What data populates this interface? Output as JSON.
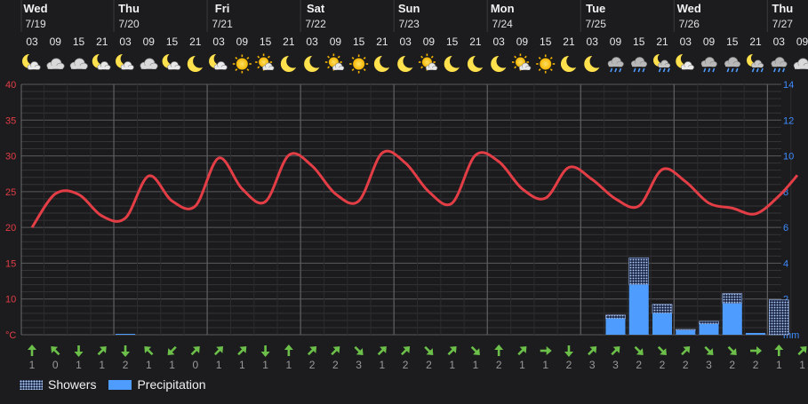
{
  "chart_data": {
    "type": "line+bar",
    "x_step_hours": 6,
    "days": [
      {
        "name": "Wed",
        "date": "7/19",
        "slot": 0
      },
      {
        "name": "Thu",
        "date": "7/20",
        "slot": 4
      },
      {
        "name": "Fri",
        "date": "7/21",
        "slot": 8
      },
      {
        "name": "Sat",
        "date": "7/22",
        "slot": 12
      },
      {
        "name": "Sun",
        "date": "7/23",
        "slot": 16
      },
      {
        "name": "Mon",
        "date": "7/24",
        "slot": 20
      },
      {
        "name": "Tue",
        "date": "7/25",
        "slot": 24
      },
      {
        "name": "Wed",
        "date": "7/26",
        "slot": 28
      },
      {
        "name": "Thu",
        "date": "7/27",
        "slot": 32
      }
    ],
    "hours": [
      "03",
      "09",
      "15",
      "21",
      "03",
      "09",
      "15",
      "21",
      "03",
      "09",
      "15",
      "21",
      "03",
      "09",
      "15",
      "21",
      "03",
      "09",
      "15",
      "21",
      "03",
      "09",
      "15",
      "21",
      "03",
      "09",
      "15",
      "21",
      "03",
      "09",
      "15",
      "21",
      "03",
      "09"
    ],
    "weather_icons": [
      "moon-cloud",
      "cloudy",
      "cloudy",
      "moon-cloud",
      "moon-cloud",
      "cloudy",
      "moon-cloud",
      "moon",
      "moon-cloud",
      "sun",
      "sun-cloud",
      "moon",
      "moon",
      "sun-cloud",
      "sun",
      "moon",
      "moon",
      "sun-cloud",
      "moon",
      "moon",
      "moon",
      "sun-cloud",
      "sun",
      "moon",
      "moon",
      "showers",
      "showers",
      "moon-showers",
      "moon-cloud",
      "showers",
      "showers",
      "moon-showers",
      "showers",
      "cloudy"
    ],
    "temperature_series": {
      "name": "Temperature",
      "unit": "°C",
      "color": "#e33d46",
      "values": [
        20,
        24.7,
        24.6,
        21.6,
        21.3,
        27.2,
        23.7,
        23.0,
        29.7,
        25.4,
        23.6,
        30.1,
        28.6,
        24.7,
        23.7,
        30.4,
        29.0,
        25.0,
        23.4,
        30.1,
        29.2,
        25.4,
        24.1,
        28.4,
        26.7,
        24.0,
        23.0,
        28.1,
        26.4,
        23.4,
        22.7,
        21.9,
        24.4,
        27.3
      ]
    },
    "precipitation_series": {
      "name": "Precipitation",
      "unit": "mm",
      "color": "#4f9cff",
      "values": [
        0,
        0,
        0,
        0,
        0.05,
        0,
        0,
        0,
        0,
        0,
        0,
        0,
        0,
        0,
        0,
        0,
        0,
        0,
        0,
        0,
        0,
        0,
        0,
        0,
        0,
        0.9,
        2.8,
        1.2,
        0.25,
        0.6,
        1.75,
        0.1,
        0,
        0
      ]
    },
    "showers_series": {
      "name": "Showers",
      "unit": "mm",
      "values": [
        0,
        0,
        0,
        0,
        0,
        0,
        0,
        0,
        0,
        0,
        0,
        0,
        0,
        0,
        0,
        0,
        0,
        0,
        0,
        0,
        0,
        0,
        0,
        0,
        0,
        0.2,
        1.5,
        0.5,
        0.05,
        0.15,
        0.55,
        0,
        1.95,
        0
      ]
    },
    "wind_dir_deg": [
      0,
      315,
      180,
      45,
      180,
      315,
      225,
      45,
      45,
      45,
      180,
      0,
      45,
      45,
      135,
      45,
      45,
      135,
      45,
      135,
      0,
      45,
      90,
      180,
      45,
      45,
      135,
      135,
      45,
      135,
      135,
      90,
      0,
      45
    ],
    "wind_speed": [
      1,
      0,
      1,
      1,
      2,
      1,
      1,
      0,
      1,
      1,
      1,
      1,
      2,
      2,
      3,
      1,
      2,
      2,
      1,
      1,
      2,
      1,
      1,
      2,
      3,
      3,
      2,
      2,
      2,
      3,
      2,
      2,
      1,
      1
    ],
    "y_left": {
      "unit": "°C",
      "min": 5,
      "max": 40,
      "ticks": [
        10,
        15,
        20,
        25,
        30,
        35,
        40
      ],
      "color": "#e33d46"
    },
    "y_right": {
      "unit": "mm",
      "min": 0,
      "max": 14,
      "ticks": [
        2,
        4,
        6,
        8,
        10,
        12,
        14
      ],
      "color": "#3d8bff"
    },
    "legend": [
      {
        "label": "Showers"
      },
      {
        "label": "Precipitation"
      }
    ],
    "grid": true,
    "legend_position": "bottom-left"
  }
}
